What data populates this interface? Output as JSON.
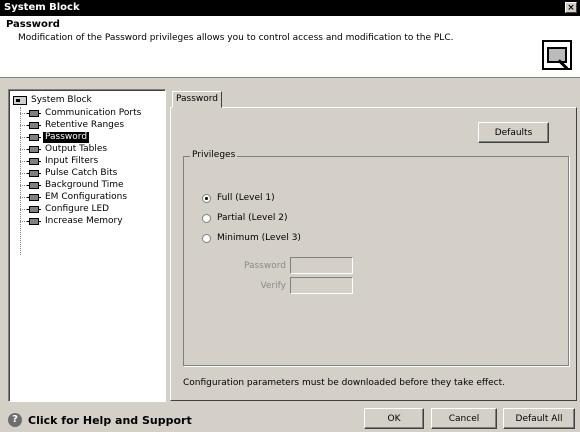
{
  "window": {
    "title": "System Block",
    "close_glyph": "×"
  },
  "header": {
    "title": "Password",
    "description": "Modification of the Password privileges allows you to control access and modification to the PLC.",
    "icon": "plc-password-icon"
  },
  "tree": {
    "root": "System Block",
    "items": [
      {
        "label": "Communication Ports"
      },
      {
        "label": "Retentive Ranges"
      },
      {
        "label": "Password"
      },
      {
        "label": "Output Tables"
      },
      {
        "label": "Input Filters"
      },
      {
        "label": "Pulse Catch Bits"
      },
      {
        "label": "Background Time"
      },
      {
        "label": "EM Configurations"
      },
      {
        "label": "Configure LED"
      },
      {
        "label": "Increase Memory"
      }
    ],
    "selected": "Password"
  },
  "tab": {
    "label": "Password"
  },
  "panel": {
    "defaults_label": "Defaults",
    "privileges_title": "Privileges",
    "options": [
      {
        "label": "Full (Level 1)",
        "checked": true
      },
      {
        "label": "Partial (Level 2)",
        "checked": false
      },
      {
        "label": "Minimum (Level 3)",
        "checked": false
      }
    ],
    "password_label": "Password",
    "password_value": "",
    "verify_label": "Verify",
    "verify_value": "",
    "note": "Configuration parameters must be downloaded before they take effect."
  },
  "footer": {
    "help_glyph": "?",
    "help_text": "Click for Help and Support",
    "ok_label": "OK",
    "cancel_label": "Cancel",
    "default_all_label": "Default All"
  }
}
